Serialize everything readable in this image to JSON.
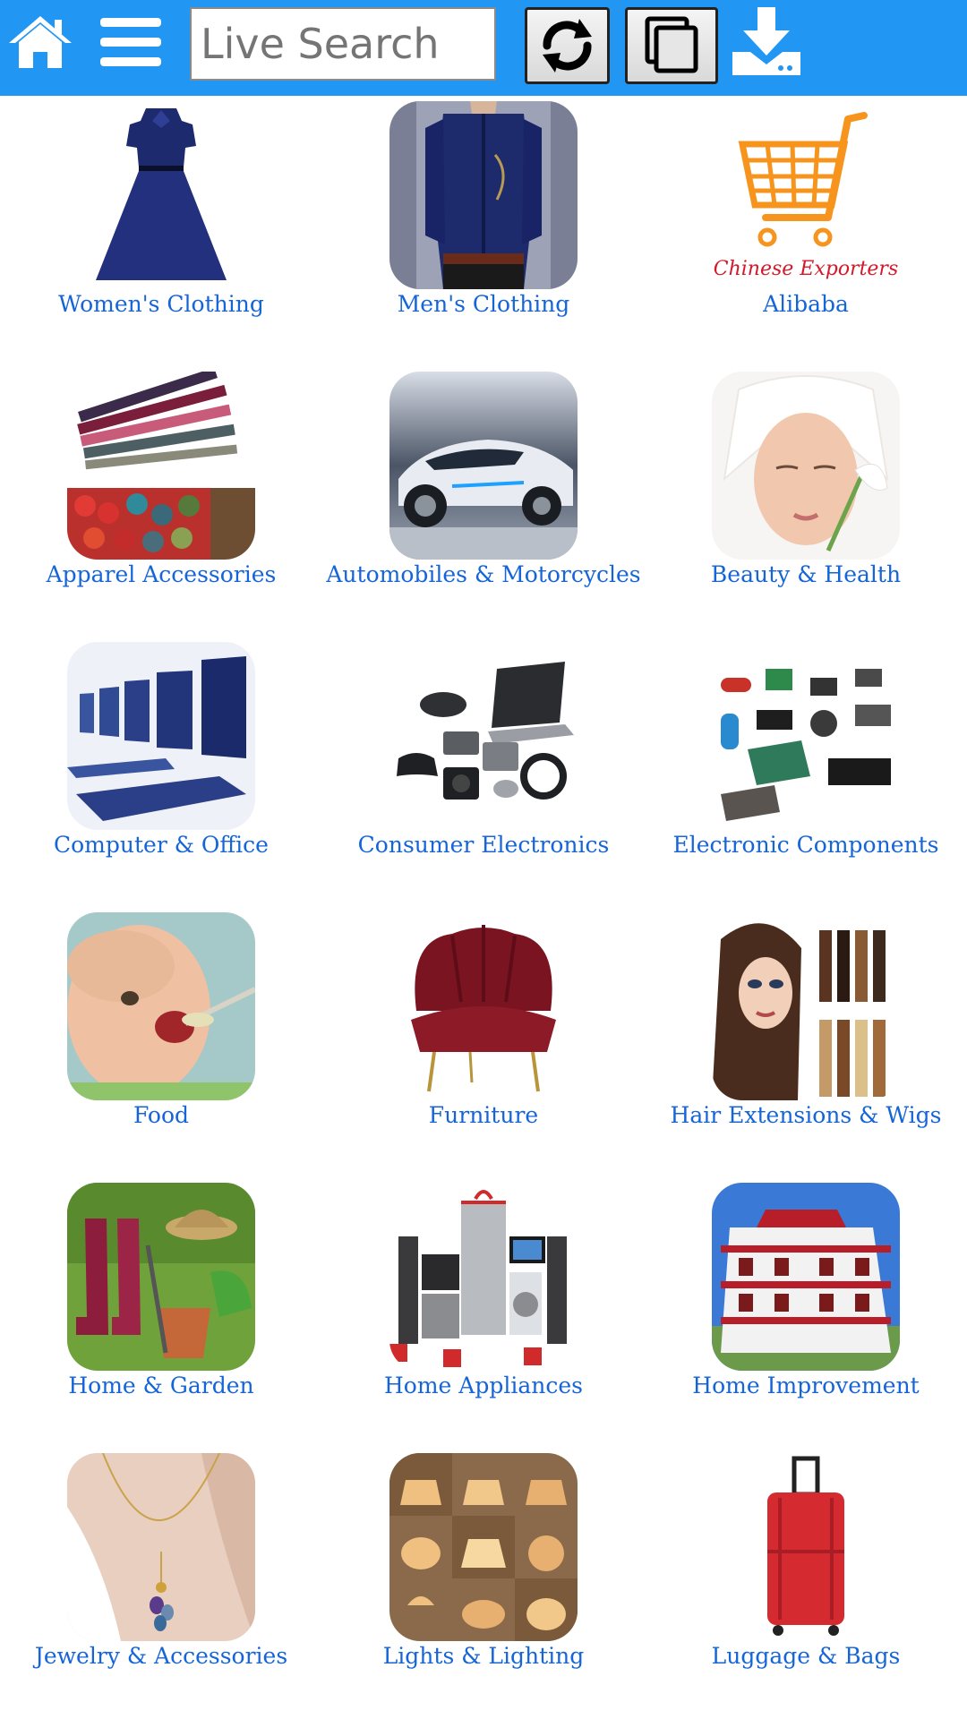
{
  "header": {
    "search_placeholder": "Live Search",
    "icons": [
      "home-icon",
      "menu-icon",
      "refresh-icon",
      "copy-icon",
      "download-icon"
    ],
    "bar_color": "#2196f3"
  },
  "categories": [
    {
      "label": "Women's Clothing",
      "icon": "dress-icon"
    },
    {
      "label": "Men's Clothing",
      "icon": "shirt-icon"
    },
    {
      "label": "Alibaba",
      "icon": "shopping-cart-icon",
      "logo_text": "Chinese Exporters"
    },
    {
      "label": "Apparel Accessories",
      "icon": "belts-buttons-icon"
    },
    {
      "label": "Automobiles & Motorcycles",
      "icon": "car-icon"
    },
    {
      "label": "Beauty & Health",
      "icon": "beauty-face-icon"
    },
    {
      "label": "Computer & Office",
      "icon": "computer-monitors-icon"
    },
    {
      "label": "Consumer Electronics",
      "icon": "gadgets-icon"
    },
    {
      "label": "Electronic Components",
      "icon": "components-icon"
    },
    {
      "label": "Food",
      "icon": "baby-food-icon"
    },
    {
      "label": "Furniture",
      "icon": "armchair-icon"
    },
    {
      "label": "Hair Extensions & Wigs",
      "icon": "hair-icon"
    },
    {
      "label": "Home & Garden",
      "icon": "garden-icon"
    },
    {
      "label": "Home Appliances",
      "icon": "appliances-icon"
    },
    {
      "label": "Home Improvement",
      "icon": "house-icon"
    },
    {
      "label": "Jewelry & Accessories",
      "icon": "necklace-icon"
    },
    {
      "label": "Lights & Lighting",
      "icon": "lamps-icon"
    },
    {
      "label": "Luggage & Bags",
      "icon": "suitcase-icon"
    }
  ]
}
